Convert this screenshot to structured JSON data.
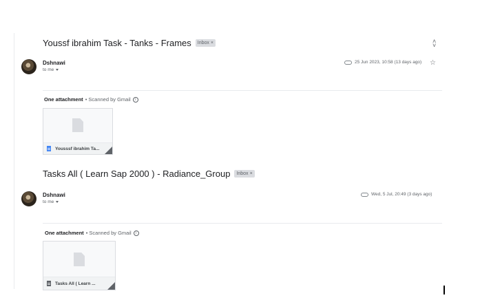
{
  "threads": [
    {
      "subject": "Youssf ibrahim Task - Tanks - Frames",
      "label": "Inbox",
      "sender": "Dshnawi",
      "to": "to me",
      "date": "25 Jun 2023, 10:58 (13 days ago)",
      "attachment_summary": "One attachment",
      "scan_note": "• Scanned by Gmail",
      "attachment_name": "Yousssf ibrahim Ta...",
      "file_icon_color": "#4285f4"
    },
    {
      "subject": "Tasks All ( Learn Sap 2000 ) - Radiance_Group",
      "label": "Inbox",
      "sender": "Dshnawi",
      "to": "to me",
      "date": "Wed, 5 Jul, 20:49 (3 days ago)",
      "attachment_summary": "One attachment",
      "scan_note": "• Scanned by Gmail",
      "attachment_name": "Tasks All ( Learn ...",
      "file_icon_color": "#5f6368"
    }
  ],
  "icons": {
    "expand": "unfold-icon",
    "star": "star-icon",
    "attachment": "paperclip-icon",
    "info": "info-icon",
    "label_remove": "close-icon"
  }
}
